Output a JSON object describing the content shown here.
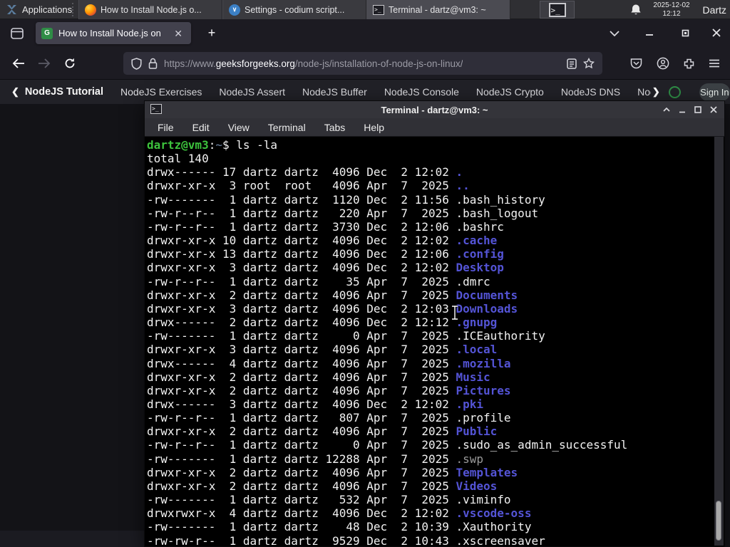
{
  "panel": {
    "applications_label": "Applications",
    "tasks": [
      {
        "icon": "firefox",
        "title": "How to Install Node.js o...",
        "active": false
      },
      {
        "icon": "codium",
        "title": "Settings - codium script...",
        "active": false
      },
      {
        "icon": "terminal",
        "title": "Terminal - dartz@vm3: ~",
        "active": true
      }
    ],
    "clock_date": "2025-12-02",
    "clock_time": "12:12",
    "user": "Dartz"
  },
  "browser": {
    "tab_title": "How to Install Node.js on",
    "new_tab_label": "+",
    "url": {
      "scheme_sub": "https://www.",
      "domain": "geeksforgeeks.org",
      "path": "/node-js/installation-of-node-js-on-linux/"
    },
    "nav_links": [
      "NodeJS Tutorial",
      "NodeJS Exercises",
      "NodeJS Assert",
      "NodeJS Buffer",
      "NodeJS Console",
      "NodeJS Crypto",
      "NodeJS DNS",
      "Node"
    ],
    "sign_in_label": "Sign In",
    "accent_green": "#2f8d46"
  },
  "terminal": {
    "title": "Terminal - dartz@vm3: ~",
    "menu": [
      "File",
      "Edit",
      "View",
      "Terminal",
      "Tabs",
      "Help"
    ],
    "prompt": {
      "user_host": "dartz@vm3",
      "colon": ":",
      "cwd": "~",
      "command": "$ ls -la"
    },
    "total_line": "total 140",
    "colors": {
      "background": "#000000",
      "foreground": "#f2f2f2",
      "directory_blue": "#5454d6",
      "prompt_green": "#3dc23d",
      "cwd_blue": "#6e84a3",
      "dim_file": "#9a9a9a"
    },
    "listing": [
      {
        "pre": "drwx------ 17 dartz dartz  4096 Dec  2 12:02 ",
        "name": ".",
        "type": "dir"
      },
      {
        "pre": "drwxr-xr-x  3 root  root   4096 Apr  7  2025 ",
        "name": "..",
        "type": "dir"
      },
      {
        "pre": "-rw-------  1 dartz dartz  1120 Dec  2 11:56 ",
        "name": ".bash_history",
        "type": "file"
      },
      {
        "pre": "-rw-r--r--  1 dartz dartz   220 Apr  7  2025 ",
        "name": ".bash_logout",
        "type": "file"
      },
      {
        "pre": "-rw-r--r--  1 dartz dartz  3730 Dec  2 12:06 ",
        "name": ".bashrc",
        "type": "file"
      },
      {
        "pre": "drwxr-xr-x 10 dartz dartz  4096 Dec  2 12:02 ",
        "name": ".cache",
        "type": "dir"
      },
      {
        "pre": "drwxr-xr-x 13 dartz dartz  4096 Dec  2 12:06 ",
        "name": ".config",
        "type": "dir"
      },
      {
        "pre": "drwxr-xr-x  3 dartz dartz  4096 Dec  2 12:02 ",
        "name": "Desktop",
        "type": "dir"
      },
      {
        "pre": "-rw-r--r--  1 dartz dartz    35 Apr  7  2025 ",
        "name": ".dmrc",
        "type": "file"
      },
      {
        "pre": "drwxr-xr-x  2 dartz dartz  4096 Apr  7  2025 ",
        "name": "Documents",
        "type": "dir"
      },
      {
        "pre": "drwxr-xr-x  3 dartz dartz  4096 Dec  2 12:03 ",
        "name": "Downloads",
        "type": "dir"
      },
      {
        "pre": "drwx------  2 dartz dartz  4096 Dec  2 12:12 ",
        "name": ".gnupg",
        "type": "dir"
      },
      {
        "pre": "-rw-------  1 dartz dartz     0 Apr  7  2025 ",
        "name": ".ICEauthority",
        "type": "file"
      },
      {
        "pre": "drwxr-xr-x  3 dartz dartz  4096 Apr  7  2025 ",
        "name": ".local",
        "type": "dir"
      },
      {
        "pre": "drwx------  4 dartz dartz  4096 Apr  7  2025 ",
        "name": ".mozilla",
        "type": "dir"
      },
      {
        "pre": "drwxr-xr-x  2 dartz dartz  4096 Apr  7  2025 ",
        "name": "Music",
        "type": "dir"
      },
      {
        "pre": "drwxr-xr-x  2 dartz dartz  4096 Apr  7  2025 ",
        "name": "Pictures",
        "type": "dir"
      },
      {
        "pre": "drwx------  3 dartz dartz  4096 Dec  2 12:02 ",
        "name": ".pki",
        "type": "dir"
      },
      {
        "pre": "-rw-r--r--  1 dartz dartz   807 Apr  7  2025 ",
        "name": ".profile",
        "type": "file"
      },
      {
        "pre": "drwxr-xr-x  2 dartz dartz  4096 Apr  7  2025 ",
        "name": "Public",
        "type": "dir"
      },
      {
        "pre": "-rw-r--r--  1 dartz dartz     0 Apr  7  2025 ",
        "name": ".sudo_as_admin_successful",
        "type": "file"
      },
      {
        "pre": "-rw-------  1 dartz dartz 12288 Apr  7  2025 ",
        "name": ".swp",
        "type": "dim"
      },
      {
        "pre": "drwxr-xr-x  2 dartz dartz  4096 Apr  7  2025 ",
        "name": "Templates",
        "type": "dir"
      },
      {
        "pre": "drwxr-xr-x  2 dartz dartz  4096 Apr  7  2025 ",
        "name": "Videos",
        "type": "dir"
      },
      {
        "pre": "-rw-------  1 dartz dartz   532 Apr  7  2025 ",
        "name": ".viminfo",
        "type": "file"
      },
      {
        "pre": "drwxrwxr-x  4 dartz dartz  4096 Dec  2 12:02 ",
        "name": ".vscode-oss",
        "type": "dir"
      },
      {
        "pre": "-rw-------  1 dartz dartz    48 Dec  2 10:39 ",
        "name": ".Xauthority",
        "type": "file"
      },
      {
        "pre": "-rw-rw-r--  1 dartz dartz  9529 Dec  2 10:43 ",
        "name": ".xscreensaver",
        "type": "file"
      }
    ]
  }
}
